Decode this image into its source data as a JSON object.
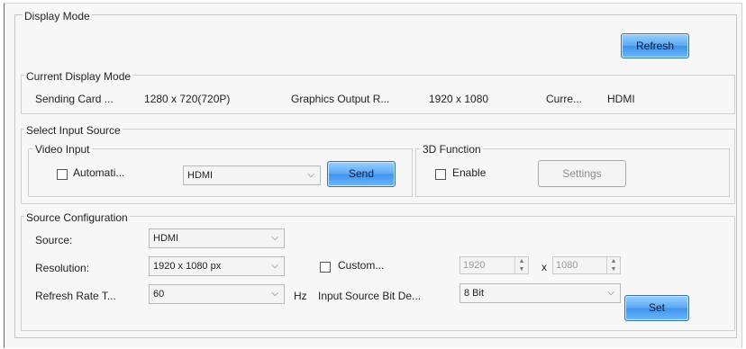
{
  "display_mode": {
    "title": "Display Mode",
    "refresh_label": "Refresh",
    "current": {
      "title": "Current Display Mode",
      "sending_card_label": "Sending Card ...",
      "sending_card_value": "1280 x 720(720P)",
      "graphics_output_label": "Graphics Output R...",
      "graphics_output_value": "1920 x 1080",
      "current_label": "Curre...",
      "current_value": "HDMI"
    }
  },
  "select_input": {
    "title": "Select Input Source",
    "video_input": {
      "title": "Video Input",
      "auto_label": "Automati...",
      "source_value": "HDMI",
      "send_label": "Send"
    },
    "function_3d": {
      "title": "3D Function",
      "enable_label": "Enable",
      "settings_label": "Settings"
    }
  },
  "source_config": {
    "title": "Source Configuration",
    "source_label": "Source:",
    "source_value": "HDMI",
    "resolution_label": "Resolution:",
    "resolution_value": "1920 x 1080 px",
    "custom_label": "Custom...",
    "width_value": "1920",
    "x_label": "x",
    "height_value": "1080",
    "refresh_rate_label": "Refresh Rate T...",
    "refresh_rate_value": "60",
    "hz_label": "Hz",
    "bit_depth_label": "Input Source Bit De...",
    "bit_depth_value": "8 Bit",
    "set_label": "Set"
  }
}
